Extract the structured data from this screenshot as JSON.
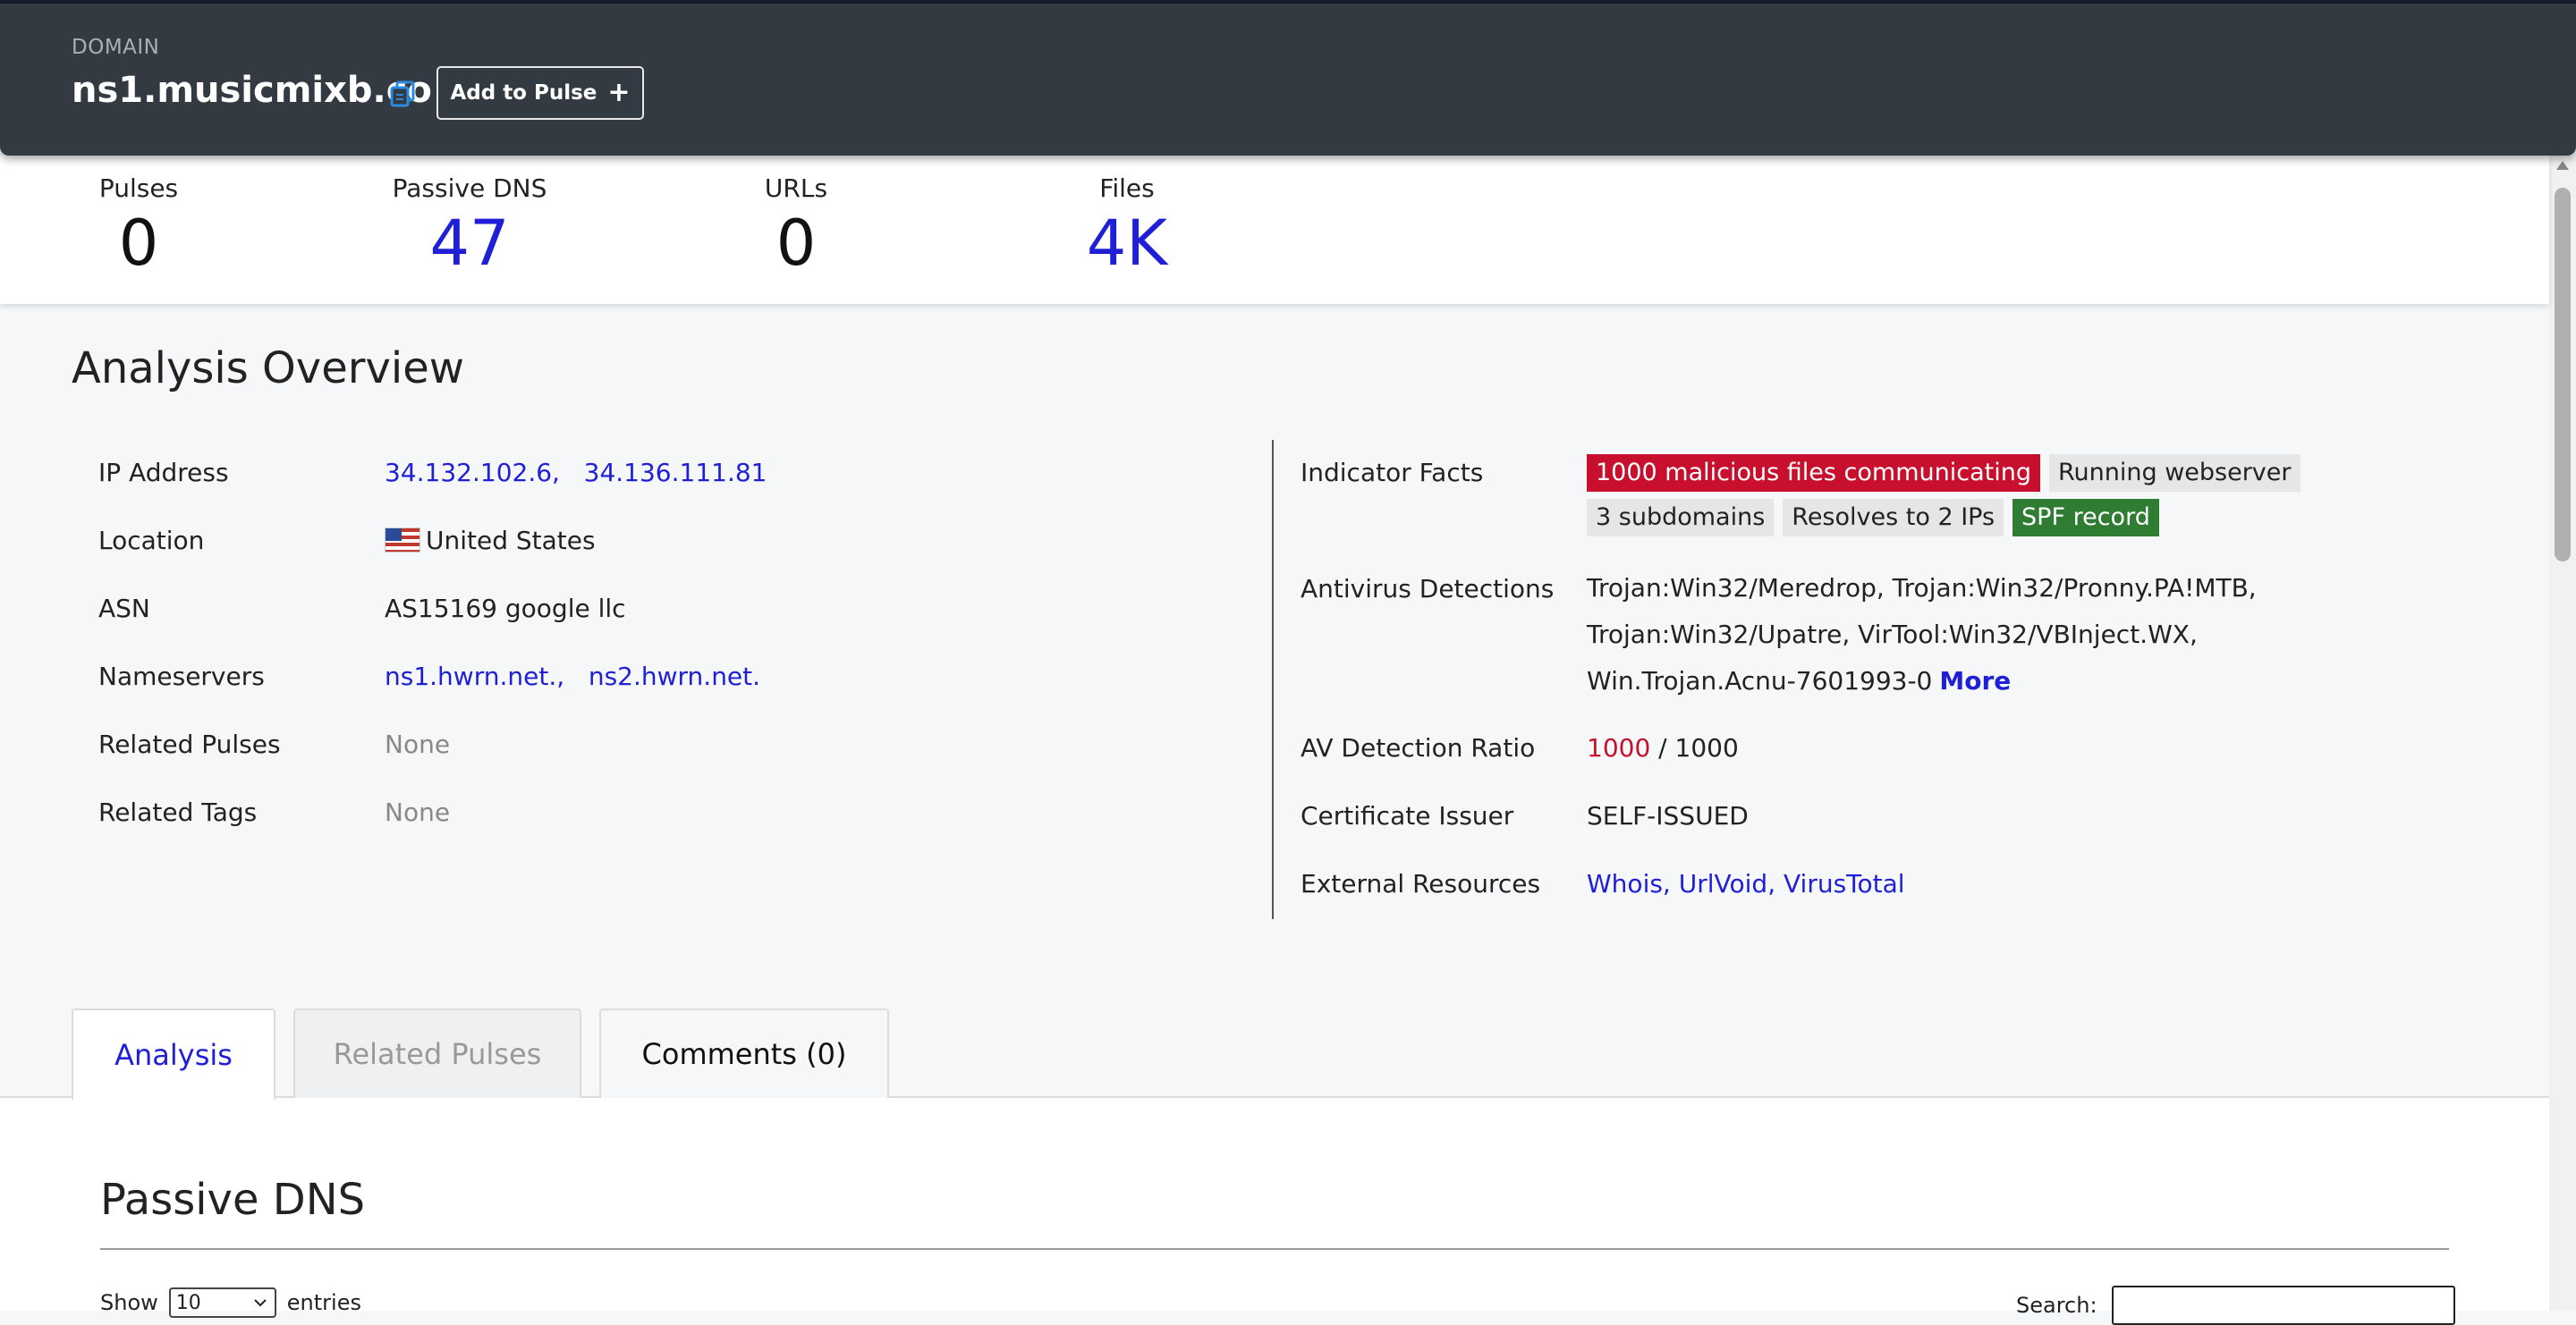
{
  "header": {
    "type_label": "DOMAIN",
    "title": "ns1.musicmixb.co",
    "copy_icon": "copy-icon",
    "add_to_pulse_label": "Add to Pulse",
    "add_icon": "plus-icon"
  },
  "stats": [
    {
      "label": "Pulses",
      "value": "0",
      "linked": false
    },
    {
      "label": "Passive DNS",
      "value": "47",
      "linked": true
    },
    {
      "label": "URLs",
      "value": "0",
      "linked": false
    },
    {
      "label": "Files",
      "value": "4K",
      "linked": true
    }
  ],
  "overview": {
    "title": "Analysis Overview",
    "left": {
      "ip_label": "IP Address",
      "ips": [
        "34.132.102.6,",
        "34.136.111.81"
      ],
      "location_label": "Location",
      "location_value": "United States",
      "asn_label": "ASN",
      "asn_value": "AS15169 google llc",
      "nameservers_label": "Nameservers",
      "nameservers": [
        "ns1.hwrn.net.,",
        "ns2.hwrn.net."
      ],
      "related_pulses_label": "Related Pulses",
      "related_pulses_value": "None",
      "related_tags_label": "Related Tags",
      "related_tags_value": "None"
    },
    "right": {
      "facts_label": "Indicator Facts",
      "facts": [
        {
          "text": "1000 malicious files communicating",
          "style": "red"
        },
        {
          "text": "Running webserver",
          "style": "gray"
        },
        {
          "text": "3 subdomains",
          "style": "gray"
        },
        {
          "text": "Resolves to 2 IPs",
          "style": "gray"
        },
        {
          "text": "SPF record",
          "style": "green"
        }
      ],
      "av_label": "Antivirus Detections",
      "av_lines": [
        "Trojan:Win32/Meredrop,   Trojan:Win32/Pronny.PA!MTB,",
        "Trojan:Win32/Upatre,   VirTool:Win32/VBInject.WX,",
        "Win.Trojan.Acnu-7601993-0"
      ],
      "av_more": "More",
      "ratio_label": "AV Detection Ratio",
      "ratio_malicious": "1000",
      "ratio_total": " / 1000",
      "cert_label": "Certificate Issuer",
      "cert_value": "SELF-ISSUED",
      "ext_label": "External Resources",
      "ext_links": [
        "Whois,",
        "UrlVoid,",
        "VirusTotal"
      ]
    }
  },
  "tabs": [
    {
      "label": "Analysis",
      "state": "active"
    },
    {
      "label": "Related Pulses",
      "state": "disabled"
    },
    {
      "label": "Comments (0)",
      "state": "normal"
    }
  ],
  "passive_dns": {
    "title": "Passive DNS",
    "show_label": "Show",
    "entries_value": "10",
    "entries_label": "entries",
    "search_label": "Search:",
    "search_value": ""
  },
  "colors": {
    "header_bg": "#343a42",
    "link": "#1f1fd8",
    "malicious": "#c8102e",
    "spf": "#2e7d32"
  }
}
